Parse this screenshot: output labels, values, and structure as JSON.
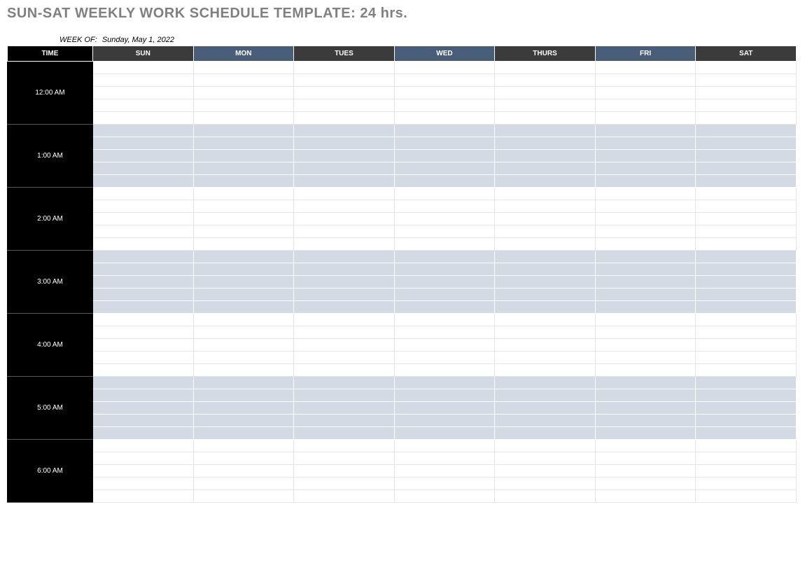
{
  "title": "SUN-SAT WEEKLY WORK SCHEDULE TEMPLATE: 24 hrs.",
  "week_of_label": "WEEK OF:",
  "week_of_value": "Sunday, May 1, 2022",
  "headers": {
    "time": "TIME",
    "days": [
      "SUN",
      "MON",
      "TUES",
      "WED",
      "THURS",
      "FRI",
      "SAT"
    ]
  },
  "time_slots": [
    {
      "label": "12:00 AM",
      "shaded": false
    },
    {
      "label": "1:00 AM",
      "shaded": true
    },
    {
      "label": "2:00 AM",
      "shaded": false
    },
    {
      "label": "3:00 AM",
      "shaded": true
    },
    {
      "label": "4:00 AM",
      "shaded": false
    },
    {
      "label": "5:00 AM",
      "shaded": true
    },
    {
      "label": "6:00 AM",
      "shaded": false
    }
  ],
  "sub_rows_per_hour": 5,
  "day_header_styles": [
    "dark",
    "blue",
    "dark",
    "blue",
    "dark",
    "blue",
    "dark"
  ]
}
